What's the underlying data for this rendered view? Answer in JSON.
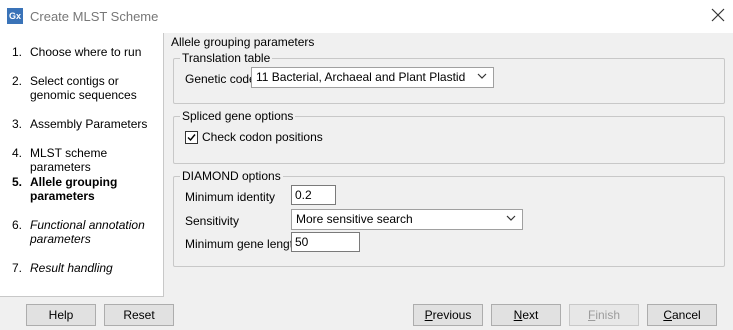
{
  "window": {
    "title": "Create MLST Scheme",
    "app_icon": "Gx"
  },
  "steps": [
    {
      "num": "1.",
      "label": "Choose where to run"
    },
    {
      "num": "2.",
      "label": "Select contigs or genomic sequences"
    },
    {
      "num": "3.",
      "label": "Assembly Parameters"
    },
    {
      "num": "4.",
      "label": "MLST scheme parameters"
    },
    {
      "num": "5.",
      "label": "Allele grouping parameters"
    },
    {
      "num": "6.",
      "label": "Functional annotation parameters"
    },
    {
      "num": "7.",
      "label": "Result handling"
    }
  ],
  "active_step": 5,
  "panel": {
    "title": "Allele grouping parameters",
    "translation": {
      "legend": "Translation table",
      "genetic_code_label": "Genetic code",
      "genetic_code_value": "11 Bacterial, Archaeal and Plant Plastid"
    },
    "spliced": {
      "legend": "Spliced gene options",
      "check_codon_label": "Check codon positions",
      "check_codon_checked": true
    },
    "diamond": {
      "legend": "DIAMOND options",
      "min_identity_label": "Minimum identity",
      "min_identity_value": "0.2",
      "sensitivity_label": "Sensitivity",
      "sensitivity_value": "More sensitive search",
      "min_gene_length_label": "Minimum gene length",
      "min_gene_length_value": "50"
    }
  },
  "buttons": {
    "help": "Help",
    "reset": "Reset",
    "previous": {
      "mnemonic": "P",
      "rest": "revious"
    },
    "next": {
      "mnemonic": "N",
      "rest": "ext"
    },
    "finish": {
      "mnemonic": "F",
      "rest": "inish"
    },
    "cancel": {
      "mnemonic": "C",
      "rest": "ancel"
    }
  }
}
